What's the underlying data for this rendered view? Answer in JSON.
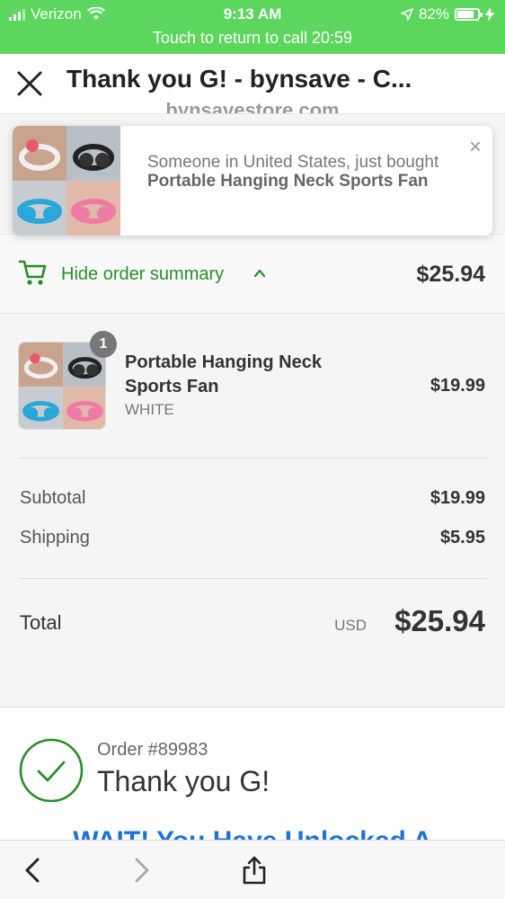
{
  "status_bar": {
    "carrier": "Verizon",
    "time": "9:13 AM",
    "battery_percent": "82%",
    "battery_level": 0.82,
    "call_banner": "Touch to return to call 20:59"
  },
  "header": {
    "title": "Thank you G! - bynsave - C...",
    "url": "bynsavestore.com"
  },
  "popup": {
    "line1": "Someone in United States, just bought ",
    "product": "Portable Hanging Neck Sports Fan",
    "close": "×"
  },
  "summary": {
    "toggle_label": "Hide order summary",
    "total": "$25.94"
  },
  "product": {
    "quantity": "1",
    "name": "Portable Hanging Neck Sports Fan",
    "variant": "WHITE",
    "price": "$19.99"
  },
  "totals": {
    "subtotal_label": "Subtotal",
    "subtotal_value": "$19.99",
    "shipping_label": "Shipping",
    "shipping_value": "$5.95",
    "total_label": "Total",
    "currency": "USD",
    "total_value": "$25.94"
  },
  "confirmation": {
    "order_number": "Order #89983",
    "thank_you": "Thank you G!",
    "unlocked_banner": "WAIT! You Have Unlocked A"
  },
  "colors": {
    "status_green": "#5cd65c",
    "accent_green": "#2a8d2a",
    "link_blue": "#1a73d9"
  },
  "icons": {
    "close": "close-icon",
    "cart": "cart-icon",
    "check": "check-circle-icon",
    "back": "back-arrow-icon",
    "forward": "forward-arrow-icon",
    "share": "share-icon"
  }
}
